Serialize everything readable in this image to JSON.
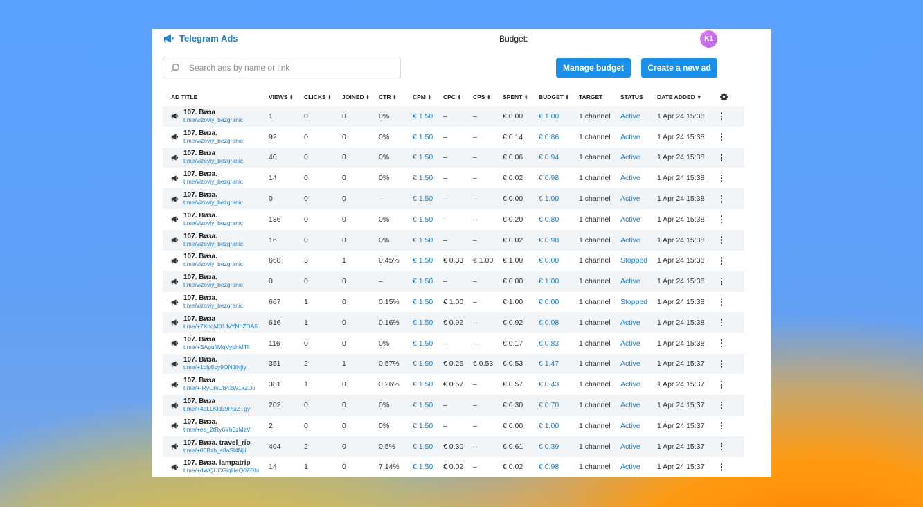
{
  "header": {
    "app_name": "Telegram Ads",
    "budget_label": "Budget:",
    "avatar_initials": "K1"
  },
  "search": {
    "placeholder": "Search ads by name or link"
  },
  "buttons": {
    "manage_budget": "Manage budget",
    "create_ad": "Create a new ad"
  },
  "table": {
    "columns": [
      "AD TITLE",
      "VIEWS",
      "CLICKS",
      "JOINED",
      "CTR",
      "CPM",
      "CPC",
      "CPS",
      "SPENT",
      "BUDGET",
      "TARGET",
      "STATUS",
      "DATE ADDED"
    ],
    "rows": [
      {
        "title": "107. Виза",
        "link": "t.me/vizoviy_bezgranic",
        "views": "1",
        "clicks": "0",
        "joined": "0",
        "ctr": "0%",
        "cpm": "€ 1.50",
        "cpc": "–",
        "cps": "–",
        "spent": "€ 0.00",
        "budget": "€ 1.00",
        "target": "1 channel",
        "status": "Active",
        "date": "1 Apr 24 15:38"
      },
      {
        "title": "107. Виза.",
        "link": "t.me/vizoviy_bezgranic",
        "views": "92",
        "clicks": "0",
        "joined": "0",
        "ctr": "0%",
        "cpm": "€ 1.50",
        "cpc": "–",
        "cps": "–",
        "spent": "€ 0.14",
        "budget": "€ 0.86",
        "target": "1 channel",
        "status": "Active",
        "date": "1 Apr 24 15:38"
      },
      {
        "title": "107. Виза",
        "link": "t.me/vizoviy_bezgranic",
        "views": "40",
        "clicks": "0",
        "joined": "0",
        "ctr": "0%",
        "cpm": "€ 1.50",
        "cpc": "–",
        "cps": "–",
        "spent": "€ 0.06",
        "budget": "€ 0.94",
        "target": "1 channel",
        "status": "Active",
        "date": "1 Apr 24 15:38"
      },
      {
        "title": "107. Виза.",
        "link": "t.me/vizoviy_bezgranic",
        "views": "14",
        "clicks": "0",
        "joined": "0",
        "ctr": "0%",
        "cpm": "€ 1.50",
        "cpc": "–",
        "cps": "–",
        "spent": "€ 0.02",
        "budget": "€ 0.98",
        "target": "1 channel",
        "status": "Active",
        "date": "1 Apr 24 15:38"
      },
      {
        "title": "107. Виза.",
        "link": "t.me/vizoviy_bezgranic",
        "views": "0",
        "clicks": "0",
        "joined": "0",
        "ctr": "–",
        "cpm": "€ 1.50",
        "cpc": "–",
        "cps": "–",
        "spent": "€ 0.00",
        "budget": "€ 1.00",
        "target": "1 channel",
        "status": "Active",
        "date": "1 Apr 24 15:38"
      },
      {
        "title": "107. Виза.",
        "link": "t.me/vizoviy_bezgranic",
        "views": "136",
        "clicks": "0",
        "joined": "0",
        "ctr": "0%",
        "cpm": "€ 1.50",
        "cpc": "–",
        "cps": "–",
        "spent": "€ 0.20",
        "budget": "€ 0.80",
        "target": "1 channel",
        "status": "Active",
        "date": "1 Apr 24 15:38"
      },
      {
        "title": "107. Виза.",
        "link": "t.me/vizoviy_bezgranic",
        "views": "16",
        "clicks": "0",
        "joined": "0",
        "ctr": "0%",
        "cpm": "€ 1.50",
        "cpc": "–",
        "cps": "–",
        "spent": "€ 0.02",
        "budget": "€ 0.98",
        "target": "1 channel",
        "status": "Active",
        "date": "1 Apr 24 15:38"
      },
      {
        "title": "107. Виза.",
        "link": "t.me/vizoviy_bezgranic",
        "views": "668",
        "clicks": "3",
        "joined": "1",
        "ctr": "0.45%",
        "cpm": "€ 1.50",
        "cpc": "€ 0.33",
        "cps": "€ 1.00",
        "spent": "€ 1.00",
        "budget": "€ 0.00",
        "target": "1 channel",
        "status": "Stopped",
        "date": "1 Apr 24 15:38"
      },
      {
        "title": "107. Виза.",
        "link": "t.me/vizoviy_bezgranic",
        "views": "0",
        "clicks": "0",
        "joined": "0",
        "ctr": "–",
        "cpm": "€ 1.50",
        "cpc": "–",
        "cps": "–",
        "spent": "€ 0.00",
        "budget": "€ 1.00",
        "target": "1 channel",
        "status": "Active",
        "date": "1 Apr 24 15:38"
      },
      {
        "title": "107. Виза.",
        "link": "t.me/vizoviy_bezgranic",
        "views": "667",
        "clicks": "1",
        "joined": "0",
        "ctr": "0.15%",
        "cpm": "€ 1.50",
        "cpc": "€ 1.00",
        "cps": "–",
        "spent": "€ 1.00",
        "budget": "€ 0.00",
        "target": "1 channel",
        "status": "Stopped",
        "date": "1 Apr 24 15:38"
      },
      {
        "title": "107. Виза",
        "link": "t.me/+7XnqM01JvYNhZDA6",
        "views": "616",
        "clicks": "1",
        "joined": "0",
        "ctr": "0.16%",
        "cpm": "€ 1.50",
        "cpc": "€ 0.92",
        "cps": "–",
        "spent": "€ 0.92",
        "budget": "€ 0.08",
        "target": "1 channel",
        "status": "Active",
        "date": "1 Apr 24 15:38"
      },
      {
        "title": "107. Виза",
        "link": "t.me/+SAgufiMqVyphMTli",
        "views": "116",
        "clicks": "0",
        "joined": "0",
        "ctr": "0%",
        "cpm": "€ 1.50",
        "cpc": "–",
        "cps": "–",
        "spent": "€ 0.17",
        "budget": "€ 0.83",
        "target": "1 channel",
        "status": "Active",
        "date": "1 Apr 24 15:38"
      },
      {
        "title": "107. Виза.",
        "link": "t.me/+1blp5cy9ONJlNjly",
        "views": "351",
        "clicks": "2",
        "joined": "1",
        "ctr": "0.57%",
        "cpm": "€ 1.50",
        "cpc": "€ 0.26",
        "cps": "€ 0.53",
        "spent": "€ 0.53",
        "budget": "€ 1.47",
        "target": "1 channel",
        "status": "Active",
        "date": "1 Apr 24 15:37"
      },
      {
        "title": "107. Виза",
        "link": "t.me/+-RyOmUb42W1kZDli",
        "views": "381",
        "clicks": "1",
        "joined": "0",
        "ctr": "0.26%",
        "cpm": "€ 1.50",
        "cpc": "€ 0.57",
        "cps": "–",
        "spent": "€ 0.57",
        "budget": "€ 0.43",
        "target": "1 channel",
        "status": "Active",
        "date": "1 Apr 24 15:37"
      },
      {
        "title": "107. Виза",
        "link": "t.me/+4dLLKld39P5iZTgy",
        "views": "202",
        "clicks": "0",
        "joined": "0",
        "ctr": "0%",
        "cpm": "€ 1.50",
        "cpc": "–",
        "cps": "–",
        "spent": "€ 0.30",
        "budget": "€ 0.70",
        "target": "1 channel",
        "status": "Active",
        "date": "1 Apr 24 15:37"
      },
      {
        "title": "107. Виза.",
        "link": "t.me/+ea_2tRy6Yh0zMzVi",
        "views": "2",
        "clicks": "0",
        "joined": "0",
        "ctr": "0%",
        "cpm": "€ 1.50",
        "cpc": "–",
        "cps": "–",
        "spent": "€ 0.00",
        "budget": "€ 1.00",
        "target": "1 channel",
        "status": "Active",
        "date": "1 Apr 24 15:37"
      },
      {
        "title": "107. Виза. travel_rio",
        "link": "t.me/+00Bzb_s8aSl4Njli",
        "views": "404",
        "clicks": "2",
        "joined": "0",
        "ctr": "0.5%",
        "cpm": "€ 1.50",
        "cpc": "€ 0.30",
        "cps": "–",
        "spent": "€ 0.61",
        "budget": "€ 0.39",
        "target": "1 channel",
        "status": "Active",
        "date": "1 Apr 24 15:37"
      },
      {
        "title": "107. Виза. lampatrip",
        "link": "t.me/+dWQUCGiqHeQ0ZDhi",
        "views": "14",
        "clicks": "1",
        "joined": "0",
        "ctr": "7.14%",
        "cpm": "€ 1.50",
        "cpc": "€ 0.02",
        "cps": "–",
        "spent": "€ 0.02",
        "budget": "€ 0.98",
        "target": "1 channel",
        "status": "Active",
        "date": "1 Apr 24 15:37"
      }
    ]
  },
  "icons": {
    "logo": "megaphone-icon",
    "search": "search-icon",
    "row": "megaphone-icon",
    "settings": "gear-icon",
    "row_menu": "more-vertical-icon"
  },
  "colors": {
    "accent": "#2481cc",
    "button": "#1a90ea",
    "avatar": "#c56cec",
    "row_stripe": "#f2f5f8"
  }
}
